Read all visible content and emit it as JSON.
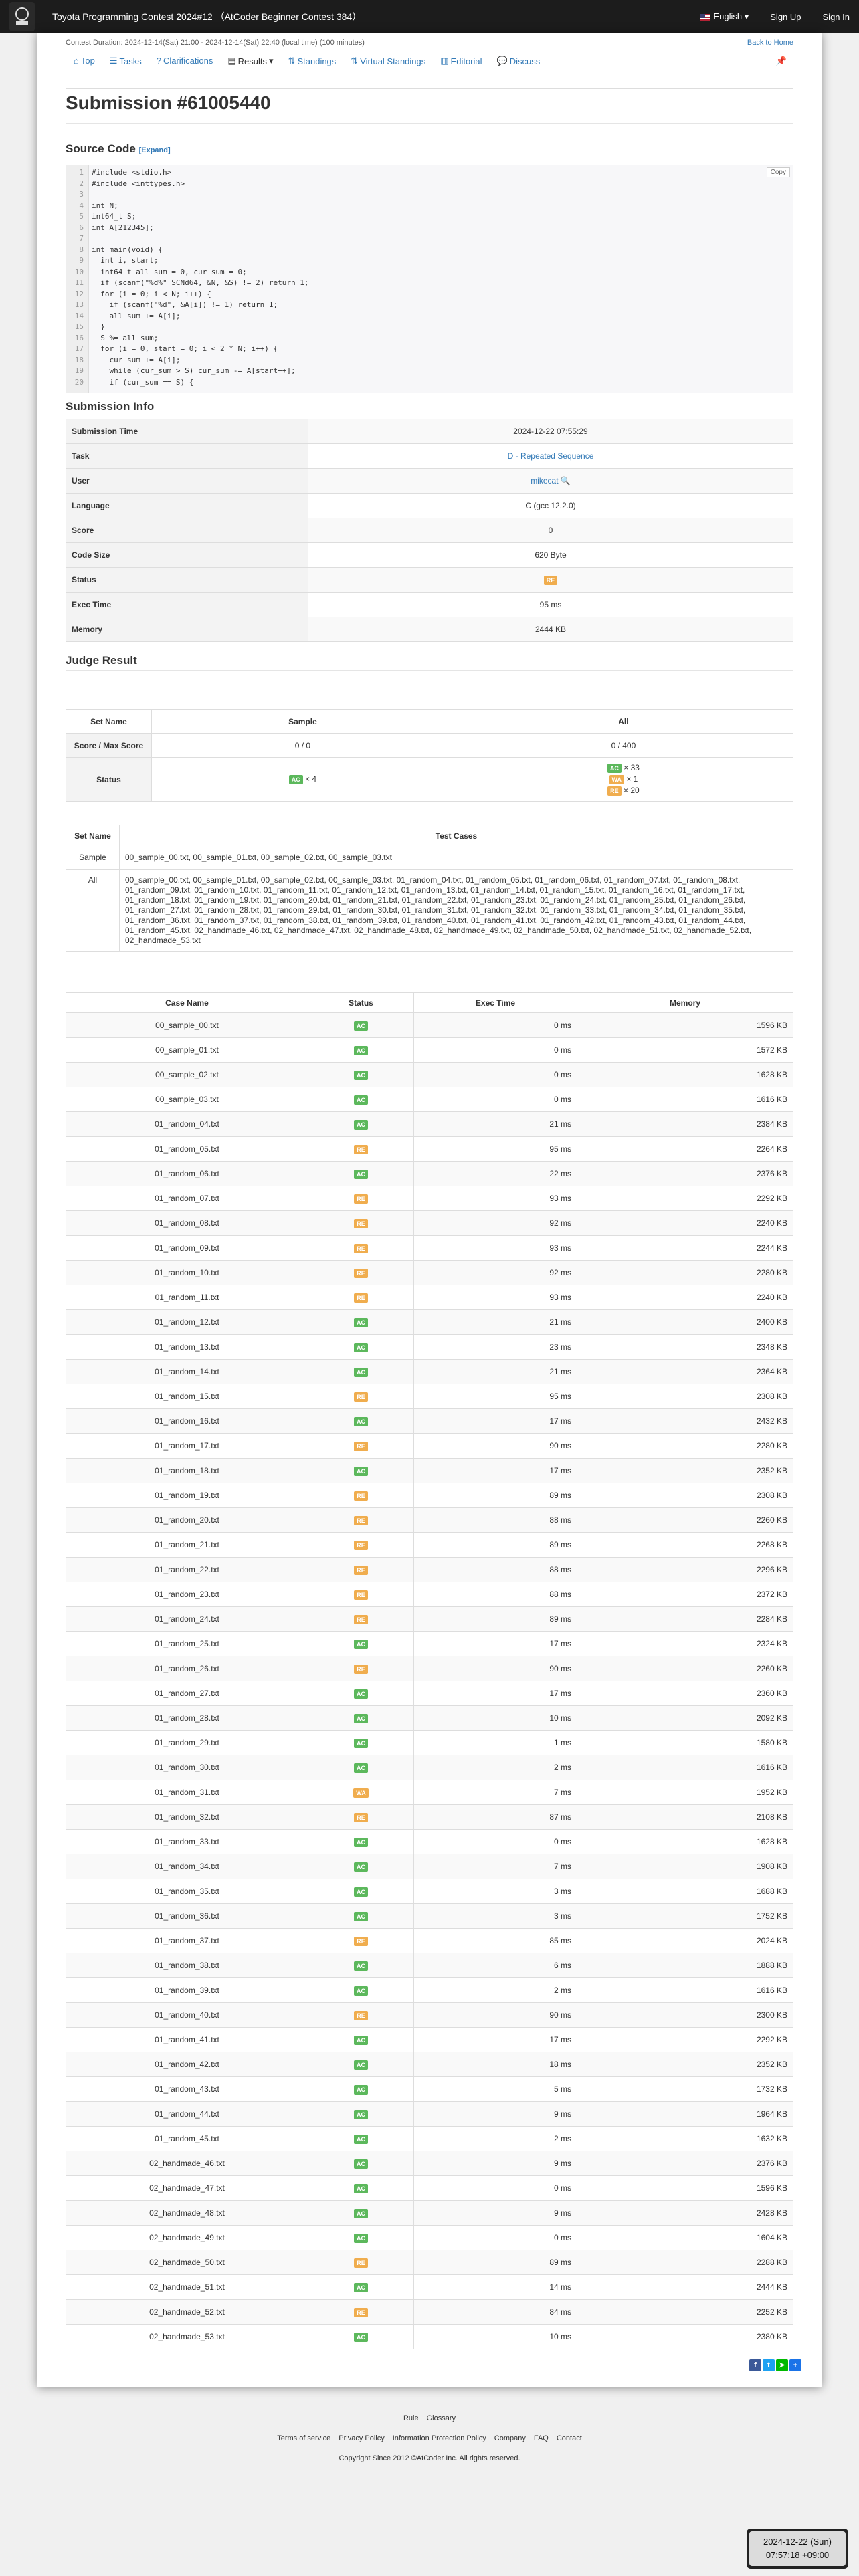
{
  "topbar": {
    "contest_title": "Toyota Programming Contest 2024#12 （AtCoder Beginner Contest 384）",
    "language": "English",
    "sign_up": "Sign Up",
    "sign_in": "Sign In"
  },
  "contest": {
    "duration": "Contest Duration: 2024-12-14(Sat) 21:00 - 2024-12-14(Sat) 22:40 (local time) (100 minutes)",
    "back_home": "Back to Home"
  },
  "nav": {
    "top": "Top",
    "tasks": "Tasks",
    "clarifications": "Clarifications",
    "results": "Results",
    "standings": "Standings",
    "virtual_standings": "Virtual Standings",
    "editorial": "Editorial",
    "discuss": "Discuss"
  },
  "page_title": "Submission #61005440",
  "source": {
    "heading": "Source Code",
    "expand": "[Expand]",
    "copy": "Copy",
    "lines": [
      "#include <stdio.h>",
      "#include <inttypes.h>",
      "",
      "int N;",
      "int64_t S;",
      "int A[212345];",
      "",
      "int main(void) {",
      "  int i, start;",
      "  int64_t all_sum = 0, cur_sum = 0;",
      "  if (scanf(\"%d%\" SCNd64, &N, &S) != 2) return 1;",
      "  for (i = 0; i < N; i++) {",
      "    if (scanf(\"%d\", &A[i]) != 1) return 1;",
      "    all_sum += A[i];",
      "  }",
      "  S %= all_sum;",
      "  for (i = 0, start = 0; i < 2 * N; i++) {",
      "    cur_sum += A[i];",
      "    while (cur_sum > S) cur_sum -= A[start++];",
      "    if (cur_sum == S) {"
    ]
  },
  "submission_info": {
    "heading": "Submission Info",
    "rows": [
      {
        "key": "Submission Time",
        "value": "2024-12-22 07:55:29"
      },
      {
        "key": "Task",
        "value": "D - Repeated Sequence"
      },
      {
        "key": "User",
        "value": "mikecat"
      },
      {
        "key": "Language",
        "value": "C (gcc 12.2.0)"
      },
      {
        "key": "Score",
        "value": "0"
      },
      {
        "key": "Code Size",
        "value": "620 Byte"
      },
      {
        "key": "Status",
        "value": "RE"
      },
      {
        "key": "Exec Time",
        "value": "95 ms"
      },
      {
        "key": "Memory",
        "value": "2444 KB"
      }
    ]
  },
  "judge": {
    "heading": "Judge Result",
    "set_name": "Set Name",
    "sample": "Sample",
    "all": "All",
    "score_label": "Score / Max Score",
    "sample_score": "0 / 0",
    "all_score": "0 / 400",
    "status_label": "Status",
    "sample_status": [
      {
        "label": "AC",
        "count": "× 4"
      }
    ],
    "all_status": [
      {
        "label": "AC",
        "count": "× 33"
      },
      {
        "label": "WA",
        "count": "× 1"
      },
      {
        "label": "RE",
        "count": "× 20"
      }
    ]
  },
  "test_sets": {
    "col_name": "Set Name",
    "col_cases": "Test Cases",
    "rows": [
      {
        "name": "Sample",
        "cases": "00_sample_00.txt, 00_sample_01.txt, 00_sample_02.txt, 00_sample_03.txt"
      },
      {
        "name": "All",
        "cases": "00_sample_00.txt, 00_sample_01.txt, 00_sample_02.txt, 00_sample_03.txt, 01_random_04.txt, 01_random_05.txt, 01_random_06.txt, 01_random_07.txt, 01_random_08.txt, 01_random_09.txt, 01_random_10.txt, 01_random_11.txt, 01_random_12.txt, 01_random_13.txt, 01_random_14.txt, 01_random_15.txt, 01_random_16.txt, 01_random_17.txt, 01_random_18.txt, 01_random_19.txt, 01_random_20.txt, 01_random_21.txt, 01_random_22.txt, 01_random_23.txt, 01_random_24.txt, 01_random_25.txt, 01_random_26.txt, 01_random_27.txt, 01_random_28.txt, 01_random_29.txt, 01_random_30.txt, 01_random_31.txt, 01_random_32.txt, 01_random_33.txt, 01_random_34.txt, 01_random_35.txt, 01_random_36.txt, 01_random_37.txt, 01_random_38.txt, 01_random_39.txt, 01_random_40.txt, 01_random_41.txt, 01_random_42.txt, 01_random_43.txt, 01_random_44.txt, 01_random_45.txt, 02_handmade_46.txt, 02_handmade_47.txt, 02_handmade_48.txt, 02_handmade_49.txt, 02_handmade_50.txt, 02_handmade_51.txt, 02_handmade_52.txt, 02_handmade_53.txt"
      }
    ]
  },
  "case_table": {
    "headers": [
      "Case Name",
      "Status",
      "Exec Time",
      "Memory"
    ],
    "rows": [
      [
        "00_sample_00.txt",
        "AC",
        "0 ms",
        "1596 KB"
      ],
      [
        "00_sample_01.txt",
        "AC",
        "0 ms",
        "1572 KB"
      ],
      [
        "00_sample_02.txt",
        "AC",
        "0 ms",
        "1628 KB"
      ],
      [
        "00_sample_03.txt",
        "AC",
        "0 ms",
        "1616 KB"
      ],
      [
        "01_random_04.txt",
        "AC",
        "21 ms",
        "2384 KB"
      ],
      [
        "01_random_05.txt",
        "RE",
        "95 ms",
        "2264 KB"
      ],
      [
        "01_random_06.txt",
        "AC",
        "22 ms",
        "2376 KB"
      ],
      [
        "01_random_07.txt",
        "RE",
        "93 ms",
        "2292 KB"
      ],
      [
        "01_random_08.txt",
        "RE",
        "92 ms",
        "2240 KB"
      ],
      [
        "01_random_09.txt",
        "RE",
        "93 ms",
        "2244 KB"
      ],
      [
        "01_random_10.txt",
        "RE",
        "92 ms",
        "2280 KB"
      ],
      [
        "01_random_11.txt",
        "RE",
        "93 ms",
        "2240 KB"
      ],
      [
        "01_random_12.txt",
        "AC",
        "21 ms",
        "2400 KB"
      ],
      [
        "01_random_13.txt",
        "AC",
        "23 ms",
        "2348 KB"
      ],
      [
        "01_random_14.txt",
        "AC",
        "21 ms",
        "2364 KB"
      ],
      [
        "01_random_15.txt",
        "RE",
        "95 ms",
        "2308 KB"
      ],
      [
        "01_random_16.txt",
        "AC",
        "17 ms",
        "2432 KB"
      ],
      [
        "01_random_17.txt",
        "RE",
        "90 ms",
        "2280 KB"
      ],
      [
        "01_random_18.txt",
        "AC",
        "17 ms",
        "2352 KB"
      ],
      [
        "01_random_19.txt",
        "RE",
        "89 ms",
        "2308 KB"
      ],
      [
        "01_random_20.txt",
        "RE",
        "88 ms",
        "2260 KB"
      ],
      [
        "01_random_21.txt",
        "RE",
        "89 ms",
        "2268 KB"
      ],
      [
        "01_random_22.txt",
        "RE",
        "88 ms",
        "2296 KB"
      ],
      [
        "01_random_23.txt",
        "RE",
        "88 ms",
        "2372 KB"
      ],
      [
        "01_random_24.txt",
        "RE",
        "89 ms",
        "2284 KB"
      ],
      [
        "01_random_25.txt",
        "AC",
        "17 ms",
        "2324 KB"
      ],
      [
        "01_random_26.txt",
        "RE",
        "90 ms",
        "2260 KB"
      ],
      [
        "01_random_27.txt",
        "AC",
        "17 ms",
        "2360 KB"
      ],
      [
        "01_random_28.txt",
        "AC",
        "10 ms",
        "2092 KB"
      ],
      [
        "01_random_29.txt",
        "AC",
        "1 ms",
        "1580 KB"
      ],
      [
        "01_random_30.txt",
        "AC",
        "2 ms",
        "1616 KB"
      ],
      [
        "01_random_31.txt",
        "WA",
        "7 ms",
        "1952 KB"
      ],
      [
        "01_random_32.txt",
        "RE",
        "87 ms",
        "2108 KB"
      ],
      [
        "01_random_33.txt",
        "AC",
        "0 ms",
        "1628 KB"
      ],
      [
        "01_random_34.txt",
        "AC",
        "7 ms",
        "1908 KB"
      ],
      [
        "01_random_35.txt",
        "AC",
        "3 ms",
        "1688 KB"
      ],
      [
        "01_random_36.txt",
        "AC",
        "3 ms",
        "1752 KB"
      ],
      [
        "01_random_37.txt",
        "RE",
        "85 ms",
        "2024 KB"
      ],
      [
        "01_random_38.txt",
        "AC",
        "6 ms",
        "1888 KB"
      ],
      [
        "01_random_39.txt",
        "AC",
        "2 ms",
        "1616 KB"
      ],
      [
        "01_random_40.txt",
        "RE",
        "90 ms",
        "2300 KB"
      ],
      [
        "01_random_41.txt",
        "AC",
        "17 ms",
        "2292 KB"
      ],
      [
        "01_random_42.txt",
        "AC",
        "18 ms",
        "2352 KB"
      ],
      [
        "01_random_43.txt",
        "AC",
        "5 ms",
        "1732 KB"
      ],
      [
        "01_random_44.txt",
        "AC",
        "9 ms",
        "1964 KB"
      ],
      [
        "01_random_45.txt",
        "AC",
        "2 ms",
        "1632 KB"
      ],
      [
        "02_handmade_46.txt",
        "AC",
        "9 ms",
        "2376 KB"
      ],
      [
        "02_handmade_47.txt",
        "AC",
        "0 ms",
        "1596 KB"
      ],
      [
        "02_handmade_48.txt",
        "AC",
        "9 ms",
        "2428 KB"
      ],
      [
        "02_handmade_49.txt",
        "AC",
        "0 ms",
        "1604 KB"
      ],
      [
        "02_handmade_50.txt",
        "RE",
        "89 ms",
        "2288 KB"
      ],
      [
        "02_handmade_51.txt",
        "AC",
        "14 ms",
        "2444 KB"
      ],
      [
        "02_handmade_52.txt",
        "RE",
        "84 ms",
        "2252 KB"
      ],
      [
        "02_handmade_53.txt",
        "AC",
        "10 ms",
        "2380 KB"
      ]
    ]
  },
  "footer": {
    "links1": [
      "Rule",
      "Glossary"
    ],
    "links2": [
      "Terms of service",
      "Privacy Policy",
      "Information Protection Policy",
      "Company",
      "FAQ",
      "Contact"
    ],
    "copyright": "Copyright Since 2012 ©AtCoder Inc. All rights reserved."
  },
  "clock": {
    "date": "2024-12-22 (Sun)",
    "time": "07:57:18 +09:00"
  },
  "colors": {
    "ac": "#5cb85c",
    "re": "#f0ad4e",
    "link": "#337ab7",
    "topbar": "#1c1c1c"
  }
}
